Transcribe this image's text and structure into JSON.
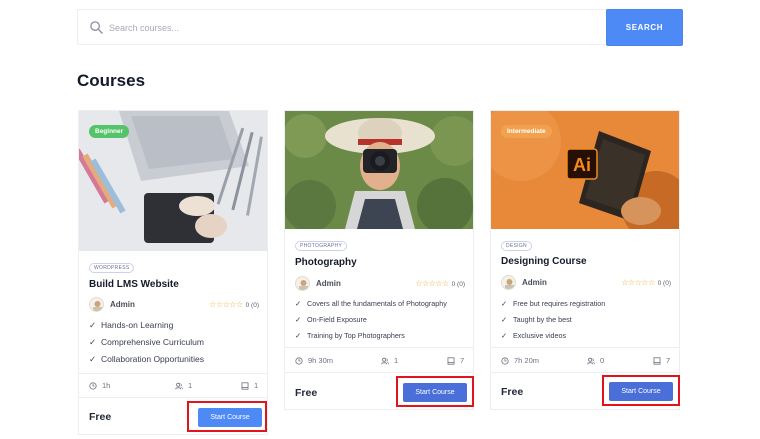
{
  "search": {
    "placeholder": "Search courses...",
    "button_label": "SEARCH"
  },
  "page_title": "Courses",
  "courses": [
    {
      "level": "Beginner",
      "level_color": "#55c36a",
      "category": "WORDPRESS",
      "title": "Build LMS Website",
      "author": "Admin",
      "rating_stars": "☆☆☆☆☆",
      "rating_count": "0 (0)",
      "features": [
        "Hands-on Learning",
        "Comprehensive Curriculum",
        "Collaboration Opportunities"
      ],
      "duration": "1h",
      "students": "1",
      "lessons": "1",
      "price": "Free",
      "button_label": "Start Course"
    },
    {
      "level": "",
      "category": "PHOTOGRAPHY",
      "title": "Photography",
      "author": "Admin",
      "rating_stars": "☆☆☆☆☆",
      "rating_count": "0 (0)",
      "features": [
        "Covers all the fundamentals of Photography",
        "On-Field Exposure",
        "Training by Top Photographers"
      ],
      "duration": "9h 30m",
      "students": "1",
      "lessons": "7",
      "price": "Free",
      "button_label": "Start Course"
    },
    {
      "level": "Intermediate",
      "level_color": "#f2a24e",
      "category": "DESIGN",
      "title": "Designing Course",
      "author": "Admin",
      "rating_stars": "☆☆☆☆☆",
      "rating_count": "0 (0)",
      "features": [
        "Free but requires registration",
        "Taught by the best",
        "Exclusive videos"
      ],
      "duration": "7h 20m",
      "students": "0",
      "lessons": "7",
      "price": "Free",
      "button_label": "Start Course",
      "thumb_logo": "Ai"
    }
  ],
  "icons": {
    "search": "search-icon",
    "check": "check-icon",
    "clock": "clock-icon",
    "students": "users-icon",
    "lessons": "book-icon"
  },
  "colors": {
    "accent": "#4d8af5",
    "button_dark": "#4b6fd8",
    "highlight": "#e3131b",
    "star": "#f1ae3a"
  }
}
